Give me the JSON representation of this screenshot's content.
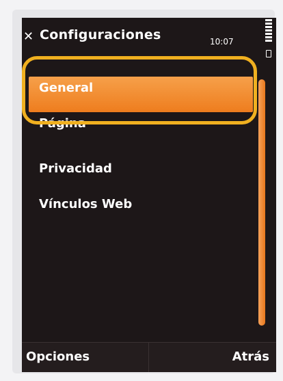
{
  "titlebar": {
    "close_glyph": "✕",
    "title": "Configuraciones",
    "time": "10:07"
  },
  "menu": {
    "items": [
      {
        "label": "General",
        "selected": true
      },
      {
        "label": "Página",
        "selected": false
      },
      {
        "label": "Privacidad",
        "selected": false
      },
      {
        "label": "Vínculos Web",
        "selected": false
      }
    ]
  },
  "softkeys": {
    "left": "Opciones",
    "right": "Atrás"
  },
  "colors": {
    "accent": "#ee7d1e",
    "highlight_ring": "#f0b020",
    "background": "#1d1718"
  }
}
